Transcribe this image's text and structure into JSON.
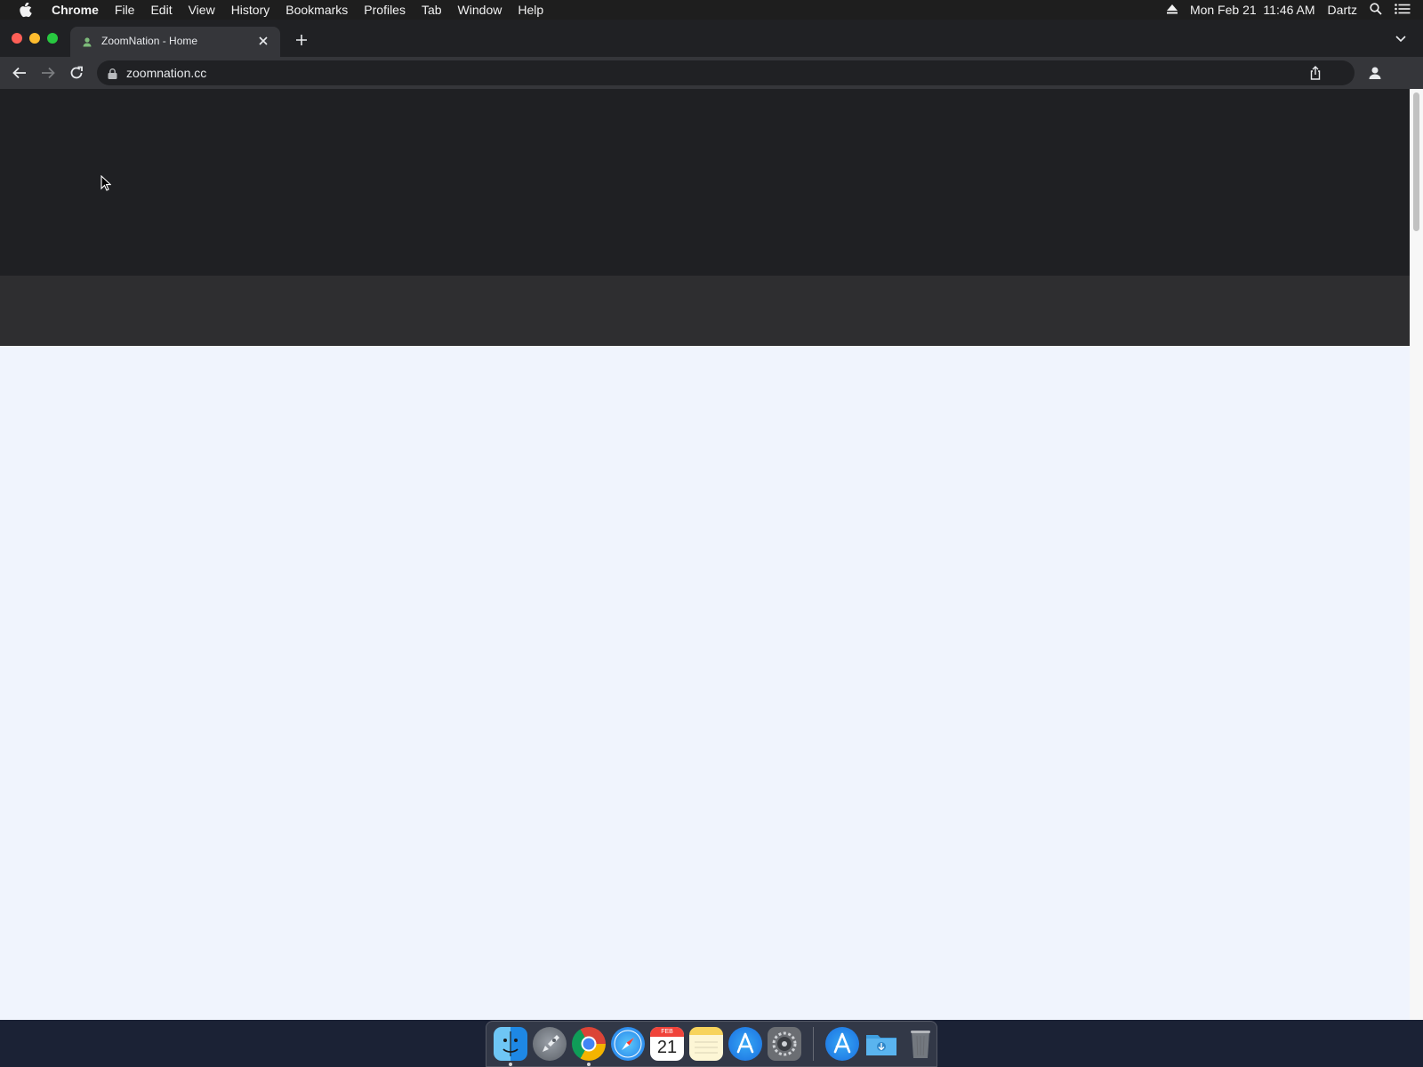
{
  "menubar": {
    "app_name": "Chrome",
    "items": [
      "File",
      "Edit",
      "View",
      "History",
      "Bookmarks",
      "Profiles",
      "Tab",
      "Window",
      "Help"
    ],
    "clock": "Mon Feb 21  11:46 AM",
    "user": "Dartz",
    "icons": [
      "apple-icon",
      "eject-icon",
      "spotlight-search-icon",
      "notification-center-icon"
    ]
  },
  "browser": {
    "tab": {
      "title": "ZoomNation - Home",
      "favicon": "zoomnation-favicon"
    },
    "address": {
      "url": "zoomnation.cc",
      "secure": true
    },
    "toolbar_icons": [
      "back-icon",
      "forward-icon",
      "reload-icon",
      "lock-icon",
      "share-icon",
      "profile-icon"
    ]
  },
  "page": {
    "hero_color": "#1f2023",
    "subbar_color": "#2e2e30",
    "body_color": "#f0f4fd"
  },
  "dock": {
    "apps": [
      {
        "name": "Finder",
        "icon": "finder-icon",
        "running": true
      },
      {
        "name": "Launchpad",
        "icon": "launchpad-icon",
        "running": false
      },
      {
        "name": "Google Chrome",
        "icon": "chrome-icon",
        "running": true
      },
      {
        "name": "Safari",
        "icon": "safari-icon",
        "running": false
      },
      {
        "name": "Calendar",
        "icon": "calendar-icon",
        "running": false,
        "month": "FEB",
        "day": "21"
      },
      {
        "name": "Notes",
        "icon": "notes-icon",
        "running": false
      },
      {
        "name": "App Store",
        "icon": "app-store-icon",
        "running": false
      },
      {
        "name": "System Preferences",
        "icon": "system-preferences-icon",
        "running": false
      },
      {
        "name": "App Store",
        "icon": "app-store-icon",
        "running": false
      },
      {
        "name": "Downloads",
        "icon": "downloads-folder-icon",
        "running": false
      },
      {
        "name": "Trash",
        "icon": "trash-icon",
        "running": false
      }
    ]
  }
}
